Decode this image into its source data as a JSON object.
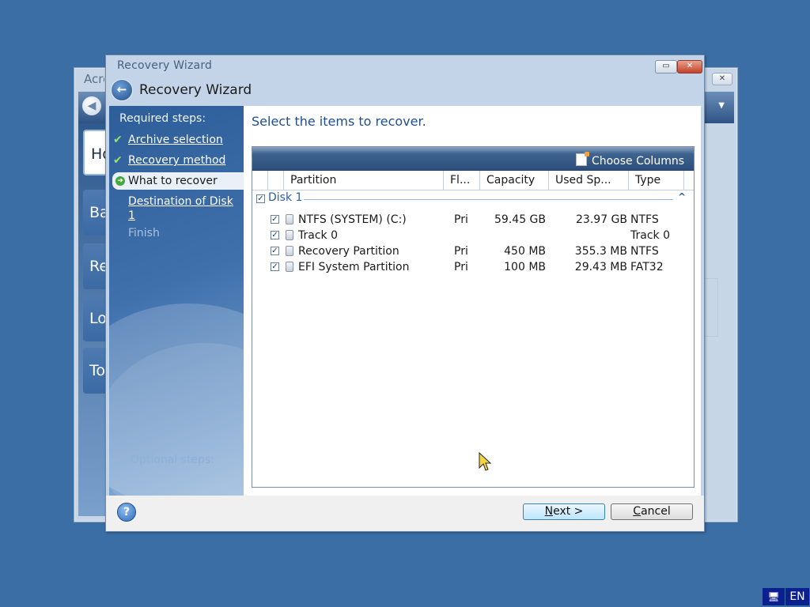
{
  "background_window": {
    "title": "Acronis",
    "tiles": [
      "Home",
      "Back",
      "Re",
      "Lo",
      "To"
    ]
  },
  "dialog": {
    "window_title": "Recovery Wizard",
    "header_title": "Recovery Wizard",
    "instruction": "Select the items to recover."
  },
  "sidebar": {
    "heading": "Required steps:",
    "steps": [
      {
        "label": "Archive selection",
        "state": "done"
      },
      {
        "label": "Recovery method",
        "state": "done"
      },
      {
        "label": "What to recover",
        "state": "current"
      },
      {
        "label": "Destination of Disk 1",
        "state": "link"
      },
      {
        "label": "Finish",
        "state": "disabled"
      }
    ],
    "optional_heading": "Optional steps:"
  },
  "list": {
    "choose_columns": "Choose Columns",
    "columns": [
      "Partition",
      "Fl...",
      "Capacity",
      "Used Sp...",
      "Type"
    ],
    "group": {
      "label": "Disk 1",
      "checked": true
    },
    "rows": [
      {
        "partition": "NTFS (SYSTEM) (C:)",
        "flags": "Pri",
        "capacity": "59.45 GB",
        "used": "23.97 GB",
        "type": "NTFS",
        "checked": true
      },
      {
        "partition": "Track 0",
        "flags": "",
        "capacity": "",
        "used": "",
        "type": "Track 0",
        "checked": true
      },
      {
        "partition": "Recovery Partition",
        "flags": "Pri",
        "capacity": "450 MB",
        "used": "355.3 MB",
        "type": "NTFS",
        "checked": true
      },
      {
        "partition": "EFI System Partition",
        "flags": "Pri",
        "capacity": "100 MB",
        "used": "29.43 MB",
        "type": "FAT32",
        "checked": true
      }
    ]
  },
  "footer": {
    "next_label": "Next >",
    "next_mnemonic": "N",
    "next_rest": "ext >",
    "cancel_label": "Cancel",
    "cancel_mnemonic": "C",
    "cancel_rest": "ancel",
    "help_symbol": "?"
  },
  "tray": {
    "language": "EN"
  },
  "colors": {
    "desktop": "#3a6ea5",
    "accent_text": "#1f4e8f",
    "sidebar_top": "#2e5e99"
  }
}
